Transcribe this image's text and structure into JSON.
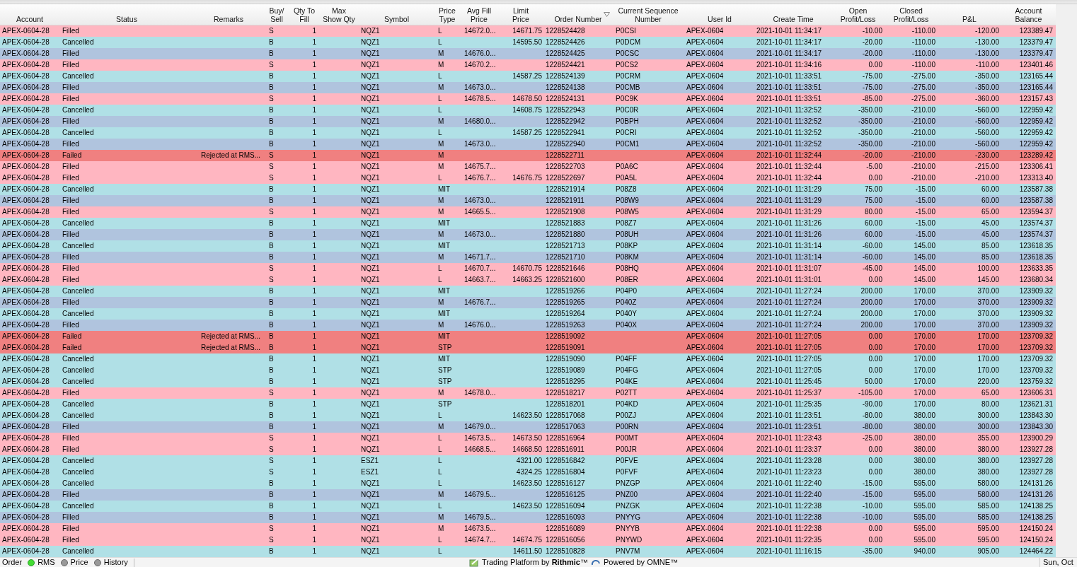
{
  "table": {
    "columns": [
      {
        "label": "Account"
      },
      {
        "label": "Status"
      },
      {
        "label": "Remarks"
      },
      {
        "label": "Buy/\nSell"
      },
      {
        "label": "Qty To\nFill"
      },
      {
        "label": "Max\nShow Qty"
      },
      {
        "label": "Symbol"
      },
      {
        "label": "Price\nType"
      },
      {
        "label": "Avg Fill\nPrice"
      },
      {
        "label": "Limit\nPrice"
      },
      {
        "label": "Order Number",
        "sorted": true
      },
      {
        "label": "Current Sequence\nNumber"
      },
      {
        "label": "User Id"
      },
      {
        "label": "Create Time"
      },
      {
        "label": "Open\nProfit/Loss"
      },
      {
        "label": "Closed\nProfit/Loss"
      },
      {
        "label": "P&L"
      },
      {
        "label": "Account\nBalance"
      }
    ],
    "rows": [
      {
        "account": "APEX-0604-28",
        "status": "Filled",
        "side": "S",
        "qty": "1",
        "symbol": "NQZ1",
        "type": "L",
        "avg_fill": "14672.0...",
        "limit": "14671.75",
        "order": "1228524428",
        "seq": "P0CSI",
        "user": "APEX-0604",
        "time": "2021-10-01 11:34:17",
        "open": "-10.00",
        "closed": "-110.00",
        "pnl": "-120.00",
        "balance": "123389.47",
        "color": "#ffb6c1"
      },
      {
        "account": "APEX-0604-28",
        "status": "Cancelled",
        "side": "B",
        "qty": "1",
        "symbol": "NQZ1",
        "type": "L",
        "limit": "14595.50",
        "order": "1228524426",
        "seq": "P0DCM",
        "user": "APEX-0604",
        "time": "2021-10-01 11:34:17",
        "open": "-20.00",
        "closed": "-110.00",
        "pnl": "-130.00",
        "balance": "123379.47",
        "color": "#b0e0e6"
      },
      {
        "account": "APEX-0604-28",
        "status": "Filled",
        "side": "B",
        "qty": "1",
        "symbol": "NQZ1",
        "type": "M",
        "avg_fill": "14676.0...",
        "order": "1228524425",
        "seq": "P0CSC",
        "user": "APEX-0604",
        "time": "2021-10-01 11:34:17",
        "open": "-20.00",
        "closed": "-110.00",
        "pnl": "-130.00",
        "balance": "123379.47",
        "color": "#b0c4de"
      },
      {
        "account": "APEX-0604-28",
        "status": "Filled",
        "side": "S",
        "qty": "1",
        "symbol": "NQZ1",
        "type": "M",
        "avg_fill": "14670.2...",
        "order": "1228524421",
        "seq": "P0CS2",
        "user": "APEX-0604",
        "time": "2021-10-01 11:34:16",
        "open": "0.00",
        "closed": "-110.00",
        "pnl": "-110.00",
        "balance": "123401.46",
        "color": "#ffb6c1"
      },
      {
        "account": "APEX-0604-28",
        "status": "Cancelled",
        "side": "B",
        "qty": "1",
        "symbol": "NQZ1",
        "type": "L",
        "limit": "14587.25",
        "order": "1228524139",
        "seq": "P0CRM",
        "user": "APEX-0604",
        "time": "2021-10-01 11:33:51",
        "open": "-75.00",
        "closed": "-275.00",
        "pnl": "-350.00",
        "balance": "123165.44",
        "color": "#b0e0e6"
      },
      {
        "account": "APEX-0604-28",
        "status": "Filled",
        "side": "B",
        "qty": "1",
        "symbol": "NQZ1",
        "type": "M",
        "avg_fill": "14673.0...",
        "order": "1228524138",
        "seq": "P0CMB",
        "user": "APEX-0604",
        "time": "2021-10-01 11:33:51",
        "open": "-75.00",
        "closed": "-275.00",
        "pnl": "-350.00",
        "balance": "123165.44",
        "color": "#b0c4de"
      },
      {
        "account": "APEX-0604-28",
        "status": "Filled",
        "side": "S",
        "qty": "1",
        "symbol": "NQZ1",
        "type": "L",
        "avg_fill": "14678.5...",
        "limit": "14678.50",
        "order": "1228524131",
        "seq": "P0C9K",
        "user": "APEX-0604",
        "time": "2021-10-01 11:33:51",
        "open": "-85.00",
        "closed": "-275.00",
        "pnl": "-360.00",
        "balance": "123157.43",
        "color": "#ffb6c1"
      },
      {
        "account": "APEX-0604-28",
        "status": "Cancelled",
        "side": "B",
        "qty": "1",
        "symbol": "NQZ1",
        "type": "L",
        "limit": "14608.75",
        "order": "1228522943",
        "seq": "P0C0R",
        "user": "APEX-0604",
        "time": "2021-10-01 11:32:52",
        "open": "-350.00",
        "closed": "-210.00",
        "pnl": "-560.00",
        "balance": "122959.42",
        "color": "#b0e0e6"
      },
      {
        "account": "APEX-0604-28",
        "status": "Filled",
        "side": "B",
        "qty": "1",
        "symbol": "NQZ1",
        "type": "M",
        "avg_fill": "14680.0...",
        "order": "1228522942",
        "seq": "P0BPH",
        "user": "APEX-0604",
        "time": "2021-10-01 11:32:52",
        "open": "-350.00",
        "closed": "-210.00",
        "pnl": "-560.00",
        "balance": "122959.42",
        "color": "#b0c4de"
      },
      {
        "account": "APEX-0604-28",
        "status": "Cancelled",
        "side": "B",
        "qty": "1",
        "symbol": "NQZ1",
        "type": "L",
        "limit": "14587.25",
        "order": "1228522941",
        "seq": "P0CRI",
        "user": "APEX-0604",
        "time": "2021-10-01 11:32:52",
        "open": "-350.00",
        "closed": "-210.00",
        "pnl": "-560.00",
        "balance": "122959.42",
        "color": "#b0e0e6"
      },
      {
        "account": "APEX-0604-28",
        "status": "Filled",
        "side": "B",
        "qty": "1",
        "symbol": "NQZ1",
        "type": "M",
        "avg_fill": "14673.0...",
        "order": "1228522940",
        "seq": "P0CM1",
        "user": "APEX-0604",
        "time": "2021-10-01 11:32:52",
        "open": "-350.00",
        "closed": "-210.00",
        "pnl": "-560.00",
        "balance": "122959.42",
        "color": "#b0c4de"
      },
      {
        "account": "APEX-0604-28",
        "status": "Failed",
        "remarks": "Rejected at RMS...",
        "side": "S",
        "qty": "1",
        "symbol": "NQZ1",
        "type": "M",
        "order": "1228522711",
        "user": "APEX-0604",
        "time": "2021-10-01 11:32:44",
        "open": "-20.00",
        "closed": "-210.00",
        "pnl": "-230.00",
        "balance": "123289.42",
        "color": "#f08080"
      },
      {
        "account": "APEX-0604-28",
        "status": "Filled",
        "side": "S",
        "qty": "1",
        "symbol": "NQZ1",
        "type": "M",
        "avg_fill": "14675.7...",
        "order": "1228522703",
        "seq": "P0A6C",
        "user": "APEX-0604",
        "time": "2021-10-01 11:32:44",
        "open": "-5.00",
        "closed": "-210.00",
        "pnl": "-215.00",
        "balance": "123306.41",
        "color": "#ffb6c1"
      },
      {
        "account": "APEX-0604-28",
        "status": "Filled",
        "side": "S",
        "qty": "1",
        "symbol": "NQZ1",
        "type": "L",
        "avg_fill": "14676.7...",
        "limit": "14676.75",
        "order": "1228522697",
        "seq": "P0A5L",
        "user": "APEX-0604",
        "time": "2021-10-01 11:32:44",
        "open": "0.00",
        "closed": "-210.00",
        "pnl": "-210.00",
        "balance": "123313.40",
        "color": "#ffb6c1"
      },
      {
        "account": "APEX-0604-28",
        "status": "Cancelled",
        "side": "B",
        "qty": "1",
        "symbol": "NQZ1",
        "type": "MIT",
        "order": "1228521914",
        "seq": "P08Z8",
        "user": "APEX-0604",
        "time": "2021-10-01 11:31:29",
        "open": "75.00",
        "closed": "-15.00",
        "pnl": "60.00",
        "balance": "123587.38",
        "color": "#b0e0e6"
      },
      {
        "account": "APEX-0604-28",
        "status": "Filled",
        "side": "B",
        "qty": "1",
        "symbol": "NQZ1",
        "type": "M",
        "avg_fill": "14673.0...",
        "order": "1228521911",
        "seq": "P08W9",
        "user": "APEX-0604",
        "time": "2021-10-01 11:31:29",
        "open": "75.00",
        "closed": "-15.00",
        "pnl": "60.00",
        "balance": "123587.38",
        "color": "#b0c4de"
      },
      {
        "account": "APEX-0604-28",
        "status": "Filled",
        "side": "S",
        "qty": "1",
        "symbol": "NQZ1",
        "type": "M",
        "avg_fill": "14665.5...",
        "order": "1228521908",
        "seq": "P08W5",
        "user": "APEX-0604",
        "time": "2021-10-01 11:31:29",
        "open": "80.00",
        "closed": "-15.00",
        "pnl": "65.00",
        "balance": "123594.37",
        "color": "#ffb6c1"
      },
      {
        "account": "APEX-0604-28",
        "status": "Cancelled",
        "side": "B",
        "qty": "1",
        "symbol": "NQZ1",
        "type": "MIT",
        "order": "1228521883",
        "seq": "P08Z7",
        "user": "APEX-0604",
        "time": "2021-10-01 11:31:26",
        "open": "60.00",
        "closed": "-15.00",
        "pnl": "45.00",
        "balance": "123574.37",
        "color": "#b0e0e6"
      },
      {
        "account": "APEX-0604-28",
        "status": "Filled",
        "side": "B",
        "qty": "1",
        "symbol": "NQZ1",
        "type": "M",
        "avg_fill": "14673.0...",
        "order": "1228521880",
        "seq": "P08UH",
        "user": "APEX-0604",
        "time": "2021-10-01 11:31:26",
        "open": "60.00",
        "closed": "-15.00",
        "pnl": "45.00",
        "balance": "123574.37",
        "color": "#b0c4de"
      },
      {
        "account": "APEX-0604-28",
        "status": "Cancelled",
        "side": "B",
        "qty": "1",
        "symbol": "NQZ1",
        "type": "MIT",
        "order": "1228521713",
        "seq": "P08KP",
        "user": "APEX-0604",
        "time": "2021-10-01 11:31:14",
        "open": "-60.00",
        "closed": "145.00",
        "pnl": "85.00",
        "balance": "123618.35",
        "color": "#b0e0e6"
      },
      {
        "account": "APEX-0604-28",
        "status": "Filled",
        "side": "B",
        "qty": "1",
        "symbol": "NQZ1",
        "type": "M",
        "avg_fill": "14671.7...",
        "order": "1228521710",
        "seq": "P08KM",
        "user": "APEX-0604",
        "time": "2021-10-01 11:31:14",
        "open": "-60.00",
        "closed": "145.00",
        "pnl": "85.00",
        "balance": "123618.35",
        "color": "#b0c4de"
      },
      {
        "account": "APEX-0604-28",
        "status": "Filled",
        "side": "S",
        "qty": "1",
        "symbol": "NQZ1",
        "type": "L",
        "avg_fill": "14670.7...",
        "limit": "14670.75",
        "order": "1228521646",
        "seq": "P08HQ",
        "user": "APEX-0604",
        "time": "2021-10-01 11:31:07",
        "open": "-45.00",
        "closed": "145.00",
        "pnl": "100.00",
        "balance": "123633.35",
        "color": "#ffb6c1"
      },
      {
        "account": "APEX-0604-28",
        "status": "Filled",
        "side": "S",
        "qty": "1",
        "symbol": "NQZ1",
        "type": "L",
        "avg_fill": "14663.7...",
        "limit": "14663.25",
        "order": "1228521600",
        "seq": "P08ER",
        "user": "APEX-0604",
        "time": "2021-10-01 11:31:01",
        "open": "0.00",
        "closed": "145.00",
        "pnl": "145.00",
        "balance": "123680.34",
        "color": "#ffb6c1"
      },
      {
        "account": "APEX-0604-28",
        "status": "Cancelled",
        "side": "B",
        "qty": "1",
        "symbol": "NQZ1",
        "type": "MIT",
        "order": "1228519266",
        "seq": "P04P0",
        "user": "APEX-0604",
        "time": "2021-10-01 11:27:24",
        "open": "200.00",
        "closed": "170.00",
        "pnl": "370.00",
        "balance": "123909.32",
        "color": "#b0e0e6"
      },
      {
        "account": "APEX-0604-28",
        "status": "Filled",
        "side": "B",
        "qty": "1",
        "symbol": "NQZ1",
        "type": "M",
        "avg_fill": "14676.7...",
        "order": "1228519265",
        "seq": "P040Z",
        "user": "APEX-0604",
        "time": "2021-10-01 11:27:24",
        "open": "200.00",
        "closed": "170.00",
        "pnl": "370.00",
        "balance": "123909.32",
        "color": "#b0c4de"
      },
      {
        "account": "APEX-0604-28",
        "status": "Cancelled",
        "side": "B",
        "qty": "1",
        "symbol": "NQZ1",
        "type": "MIT",
        "order": "1228519264",
        "seq": "P040Y",
        "user": "APEX-0604",
        "time": "2021-10-01 11:27:24",
        "open": "200.00",
        "closed": "170.00",
        "pnl": "370.00",
        "balance": "123909.32",
        "color": "#b0e0e6"
      },
      {
        "account": "APEX-0604-28",
        "status": "Filled",
        "side": "B",
        "qty": "1",
        "symbol": "NQZ1",
        "type": "M",
        "avg_fill": "14676.0...",
        "order": "1228519263",
        "seq": "P040X",
        "user": "APEX-0604",
        "time": "2021-10-01 11:27:24",
        "open": "200.00",
        "closed": "170.00",
        "pnl": "370.00",
        "balance": "123909.32",
        "color": "#b0c4de"
      },
      {
        "account": "APEX-0604-28",
        "status": "Failed",
        "remarks": "Rejected at RMS...",
        "side": "B",
        "qty": "1",
        "symbol": "NQZ1",
        "type": "MIT",
        "order": "1228519092",
        "user": "APEX-0604",
        "time": "2021-10-01 11:27:05",
        "open": "0.00",
        "closed": "170.00",
        "pnl": "170.00",
        "balance": "123709.32",
        "color": "#f08080"
      },
      {
        "account": "APEX-0604-28",
        "status": "Failed",
        "remarks": "Rejected at RMS...",
        "side": "B",
        "qty": "1",
        "symbol": "NQZ1",
        "type": "STP",
        "order": "1228519091",
        "user": "APEX-0604",
        "time": "2021-10-01 11:27:05",
        "open": "0.00",
        "closed": "170.00",
        "pnl": "170.00",
        "balance": "123709.32",
        "color": "#f08080"
      },
      {
        "account": "APEX-0604-28",
        "status": "Cancelled",
        "side": "B",
        "qty": "1",
        "symbol": "NQZ1",
        "type": "MIT",
        "order": "1228519090",
        "seq": "P04FF",
        "user": "APEX-0604",
        "time": "2021-10-01 11:27:05",
        "open": "0.00",
        "closed": "170.00",
        "pnl": "170.00",
        "balance": "123709.32",
        "color": "#b0e0e6"
      },
      {
        "account": "APEX-0604-28",
        "status": "Cancelled",
        "side": "B",
        "qty": "1",
        "symbol": "NQZ1",
        "type": "STP",
        "order": "1228519089",
        "seq": "P04FG",
        "user": "APEX-0604",
        "time": "2021-10-01 11:27:05",
        "open": "0.00",
        "closed": "170.00",
        "pnl": "170.00",
        "balance": "123709.32",
        "color": "#b0e0e6"
      },
      {
        "account": "APEX-0604-28",
        "status": "Cancelled",
        "side": "B",
        "qty": "1",
        "symbol": "NQZ1",
        "type": "STP",
        "order": "1228518295",
        "seq": "P04KE",
        "user": "APEX-0604",
        "time": "2021-10-01 11:25:45",
        "open": "50.00",
        "closed": "170.00",
        "pnl": "220.00",
        "balance": "123759.32",
        "color": "#b0e0e6"
      },
      {
        "account": "APEX-0604-28",
        "status": "Filled",
        "side": "S",
        "qty": "1",
        "symbol": "NQZ1",
        "type": "M",
        "avg_fill": "14678.0...",
        "order": "1228518217",
        "seq": "P02TT",
        "user": "APEX-0604",
        "time": "2021-10-01 11:25:37",
        "open": "-105.00",
        "closed": "170.00",
        "pnl": "65.00",
        "balance": "123606.31",
        "color": "#ffb6c1"
      },
      {
        "account": "APEX-0604-28",
        "status": "Cancelled",
        "side": "B",
        "qty": "1",
        "symbol": "NQZ1",
        "type": "STP",
        "order": "1228518201",
        "seq": "P04KD",
        "user": "APEX-0604",
        "time": "2021-10-01 11:25:35",
        "open": "-90.00",
        "closed": "170.00",
        "pnl": "80.00",
        "balance": "123621.31",
        "color": "#b0e0e6"
      },
      {
        "account": "APEX-0604-28",
        "status": "Cancelled",
        "side": "B",
        "qty": "1",
        "symbol": "NQZ1",
        "type": "L",
        "limit": "14623.50",
        "order": "1228517068",
        "seq": "P00ZJ",
        "user": "APEX-0604",
        "time": "2021-10-01 11:23:51",
        "open": "-80.00",
        "closed": "380.00",
        "pnl": "300.00",
        "balance": "123843.30",
        "color": "#b0e0e6"
      },
      {
        "account": "APEX-0604-28",
        "status": "Filled",
        "side": "B",
        "qty": "1",
        "symbol": "NQZ1",
        "type": "M",
        "avg_fill": "14679.0...",
        "order": "1228517063",
        "seq": "P00RN",
        "user": "APEX-0604",
        "time": "2021-10-01 11:23:51",
        "open": "-80.00",
        "closed": "380.00",
        "pnl": "300.00",
        "balance": "123843.30",
        "color": "#b0c4de"
      },
      {
        "account": "APEX-0604-28",
        "status": "Filled",
        "side": "S",
        "qty": "1",
        "symbol": "NQZ1",
        "type": "L",
        "avg_fill": "14673.5...",
        "limit": "14673.50",
        "order": "1228516964",
        "seq": "P00MT",
        "user": "APEX-0604",
        "time": "2021-10-01 11:23:43",
        "open": "-25.00",
        "closed": "380.00",
        "pnl": "355.00",
        "balance": "123900.29",
        "color": "#ffb6c1"
      },
      {
        "account": "APEX-0604-28",
        "status": "Filled",
        "side": "S",
        "qty": "1",
        "symbol": "NQZ1",
        "type": "L",
        "avg_fill": "14668.5...",
        "limit": "14668.50",
        "order": "1228516911",
        "seq": "P00JR",
        "user": "APEX-0604",
        "time": "2021-10-01 11:23:37",
        "open": "0.00",
        "closed": "380.00",
        "pnl": "380.00",
        "balance": "123927.28",
        "color": "#ffb6c1"
      },
      {
        "account": "APEX-0604-28",
        "status": "Cancelled",
        "side": "S",
        "qty": "1",
        "symbol": "ESZ1",
        "type": "L",
        "limit": "4321.00",
        "order": "1228516842",
        "seq": "P0FVE",
        "user": "APEX-0604",
        "time": "2021-10-01 11:23:28",
        "open": "0.00",
        "closed": "380.00",
        "pnl": "380.00",
        "balance": "123927.28",
        "color": "#b0e0e6"
      },
      {
        "account": "APEX-0604-28",
        "status": "Cancelled",
        "side": "S",
        "qty": "1",
        "symbol": "ESZ1",
        "type": "L",
        "limit": "4324.25",
        "order": "1228516804",
        "seq": "P0FVF",
        "user": "APEX-0604",
        "time": "2021-10-01 11:23:23",
        "open": "0.00",
        "closed": "380.00",
        "pnl": "380.00",
        "balance": "123927.28",
        "color": "#b0e0e6"
      },
      {
        "account": "APEX-0604-28",
        "status": "Cancelled",
        "side": "B",
        "qty": "1",
        "symbol": "NQZ1",
        "type": "L",
        "limit": "14623.50",
        "order": "1228516127",
        "seq": "PNZGP",
        "user": "APEX-0604",
        "time": "2021-10-01 11:22:40",
        "open": "-15.00",
        "closed": "595.00",
        "pnl": "580.00",
        "balance": "124131.26",
        "color": "#b0e0e6"
      },
      {
        "account": "APEX-0604-28",
        "status": "Filled",
        "side": "B",
        "qty": "1",
        "symbol": "NQZ1",
        "type": "M",
        "avg_fill": "14679.5...",
        "order": "1228516125",
        "seq": "PNZ00",
        "user": "APEX-0604",
        "time": "2021-10-01 11:22:40",
        "open": "-15.00",
        "closed": "595.00",
        "pnl": "580.00",
        "balance": "124131.26",
        "color": "#b0c4de"
      },
      {
        "account": "APEX-0604-28",
        "status": "Cancelled",
        "side": "B",
        "qty": "1",
        "symbol": "NQZ1",
        "type": "L",
        "limit": "14623.50",
        "order": "1228516094",
        "seq": "PNZGK",
        "user": "APEX-0604",
        "time": "2021-10-01 11:22:38",
        "open": "-10.00",
        "closed": "595.00",
        "pnl": "585.00",
        "balance": "124138.25",
        "color": "#b0e0e6"
      },
      {
        "account": "APEX-0604-28",
        "status": "Filled",
        "side": "B",
        "qty": "1",
        "symbol": "NQZ1",
        "type": "M",
        "avg_fill": "14679.5...",
        "order": "1228516093",
        "seq": "PNYYG",
        "user": "APEX-0604",
        "time": "2021-10-01 11:22:38",
        "open": "-10.00",
        "closed": "595.00",
        "pnl": "585.00",
        "balance": "124138.25",
        "color": "#b0c4de"
      },
      {
        "account": "APEX-0604-28",
        "status": "Filled",
        "side": "S",
        "qty": "1",
        "symbol": "NQZ1",
        "type": "M",
        "avg_fill": "14673.5...",
        "order": "1228516089",
        "seq": "PNYYB",
        "user": "APEX-0604",
        "time": "2021-10-01 11:22:38",
        "open": "0.00",
        "closed": "595.00",
        "pnl": "595.00",
        "balance": "124150.24",
        "color": "#ffb6c1"
      },
      {
        "account": "APEX-0604-28",
        "status": "Filled",
        "side": "S",
        "qty": "1",
        "symbol": "NQZ1",
        "type": "L",
        "avg_fill": "14674.7...",
        "limit": "14674.75",
        "order": "1228516056",
        "seq": "PNYWD",
        "user": "APEX-0604",
        "time": "2021-10-01 11:22:35",
        "open": "0.00",
        "closed": "595.00",
        "pnl": "595.00",
        "balance": "124150.24",
        "color": "#ffb6c1"
      },
      {
        "account": "APEX-0604-28",
        "status": "Cancelled",
        "side": "B",
        "qty": "1",
        "symbol": "NQZ1",
        "type": "L",
        "limit": "14611.50",
        "order": "1228510828",
        "seq": "PNV7M",
        "user": "APEX-0604",
        "time": "2021-10-01 11:16:15",
        "open": "-35.00",
        "closed": "940.00",
        "pnl": "905.00",
        "balance": "124464.22",
        "color": "#b0e0e6"
      }
    ]
  },
  "status_bar": {
    "label": "Order",
    "indicators": [
      {
        "label": "RMS",
        "on": true
      },
      {
        "label": "Price",
        "on": false
      },
      {
        "label": "History",
        "on": false
      }
    ],
    "credit": "Trading Platform by **Rithmic**™",
    "powered": "Powered by OMNE™",
    "date": "Sun, Oct"
  }
}
